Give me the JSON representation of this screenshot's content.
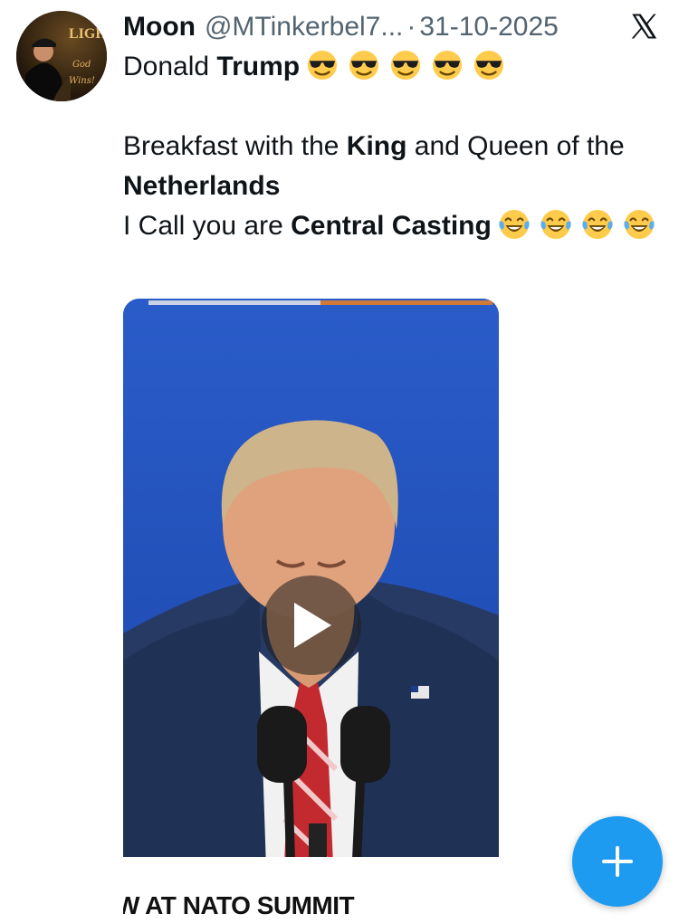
{
  "author": {
    "name": "Moon",
    "handle": "@MTinkerbel7...",
    "separator": "·",
    "date": "31-10-2025",
    "avatar_text": "LIGHT"
  },
  "tweet": {
    "line1_plain": "Donald ",
    "line1_bold": "Trump",
    "line1_emoji": "smiling-face-with-sunglasses",
    "line1_emoji_count": 5,
    "line2_a": "Breakfast with the ",
    "line2_b": "King",
    "line2_c": " and Queen of the ",
    "line2_d": "Netherlands",
    "line3_a": "I Call you are ",
    "line3_b": "Central Casting",
    "line3_emoji": "face-with-tears-of-joy",
    "line3_emoji_count": 4
  },
  "media": {
    "type": "video",
    "caption": "W AT NATO SUMMIT",
    "background_color": "#1d4fb8"
  },
  "icons": {
    "platform_logo": "x-logo-icon",
    "play": "play-icon",
    "compose": "plus-icon"
  },
  "colors": {
    "accent": "#1d9bf0",
    "text": "#0f1419",
    "secondary_text": "#536471"
  }
}
